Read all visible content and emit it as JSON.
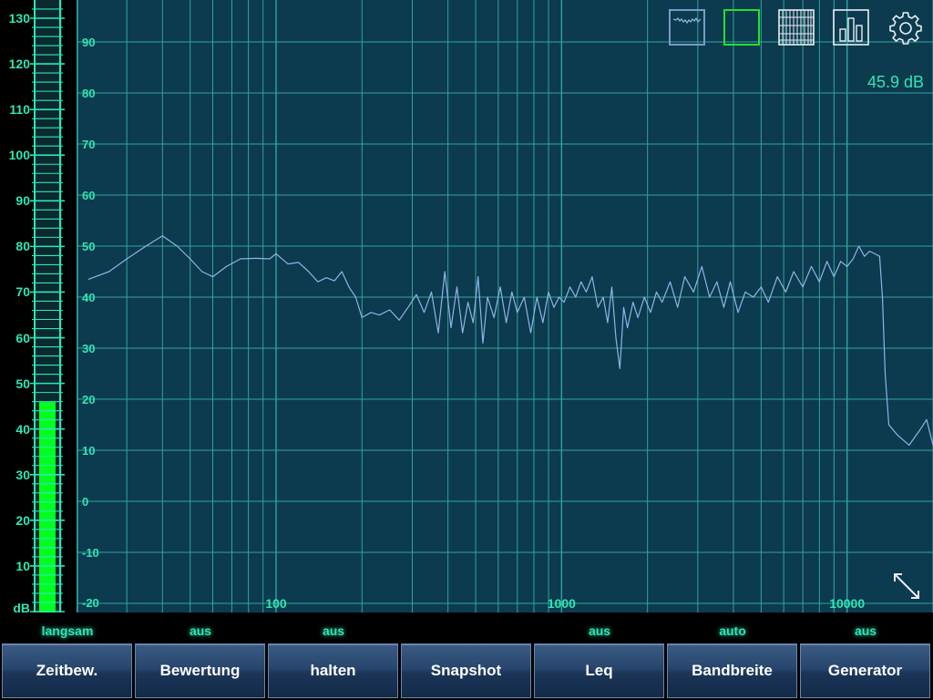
{
  "meter": {
    "unit_label": "dB",
    "scale_labels": [
      "130",
      "120",
      "110",
      "100",
      "90",
      "80",
      "70",
      "60",
      "50",
      "40",
      "30",
      "20",
      "10"
    ],
    "level_db": 45.9,
    "scale_min": 0,
    "scale_max": 130,
    "bar_color": "#00ff1e",
    "scale_color": "#2fe6b4"
  },
  "plot": {
    "background": "#0c3a4e",
    "grid_color": "#2fa5a0",
    "line_color": "#8fb4e8",
    "y_labels": [
      "90",
      "80",
      "70",
      "60",
      "50",
      "40",
      "30",
      "20",
      "10",
      "0",
      "-10",
      "-20"
    ],
    "x_labels": [
      "100",
      "1000",
      "10000"
    ],
    "level_readout": "45.9 dB"
  },
  "toolbar_icons": [
    {
      "name": "spectrum-view-icon",
      "label": "spectrum view"
    },
    {
      "name": "blank-view-icon",
      "label": "blank view"
    },
    {
      "name": "grid-view-icon",
      "label": "grid view"
    },
    {
      "name": "bar-chart-view-icon",
      "label": "bar chart view"
    },
    {
      "name": "settings-gear-icon",
      "label": "settings"
    }
  ],
  "chart_data": {
    "type": "line",
    "xscale": "log",
    "xlim": [
      20,
      20000
    ],
    "ylim": [
      -20,
      100
    ],
    "x_ticks": [
      100,
      1000,
      10000
    ],
    "y_ticks": [
      -20,
      -10,
      0,
      10,
      20,
      30,
      40,
      50,
      60,
      70,
      80,
      90
    ],
    "grid": true,
    "series": [
      {
        "points": [
          [
            22,
            43.5
          ],
          [
            26,
            45
          ],
          [
            30,
            47.5
          ],
          [
            35,
            50
          ],
          [
            40,
            52
          ],
          [
            45,
            50
          ],
          [
            50,
            47.5
          ],
          [
            55,
            45
          ],
          [
            60,
            44
          ],
          [
            67,
            46
          ],
          [
            75,
            47.5
          ],
          [
            85,
            47.6
          ],
          [
            95,
            47.5
          ],
          [
            100,
            48.5
          ],
          [
            110,
            46.5
          ],
          [
            120,
            46.8
          ],
          [
            130,
            45
          ],
          [
            140,
            43
          ],
          [
            150,
            43.8
          ],
          [
            160,
            43.2
          ],
          [
            170,
            45
          ],
          [
            180,
            42
          ],
          [
            190,
            40
          ],
          [
            200,
            36
          ],
          [
            215,
            37
          ],
          [
            230,
            36.5
          ],
          [
            250,
            37.5
          ],
          [
            270,
            35.5
          ],
          [
            290,
            38
          ],
          [
            310,
            40.5
          ],
          [
            330,
            37
          ],
          [
            350,
            41
          ],
          [
            370,
            33
          ],
          [
            390,
            45
          ],
          [
            410,
            34
          ],
          [
            430,
            42
          ],
          [
            450,
            33
          ],
          [
            470,
            39
          ],
          [
            490,
            35
          ],
          [
            510,
            44
          ],
          [
            530,
            31
          ],
          [
            550,
            40
          ],
          [
            580,
            36
          ],
          [
            610,
            42
          ],
          [
            640,
            35
          ],
          [
            670,
            41
          ],
          [
            700,
            37
          ],
          [
            740,
            40
          ],
          [
            780,
            33
          ],
          [
            820,
            40
          ],
          [
            860,
            35
          ],
          [
            900,
            41
          ],
          [
            940,
            38
          ],
          [
            980,
            40
          ],
          [
            1020,
            39
          ],
          [
            1070,
            42
          ],
          [
            1120,
            40
          ],
          [
            1170,
            43
          ],
          [
            1220,
            41
          ],
          [
            1280,
            44
          ],
          [
            1340,
            38
          ],
          [
            1400,
            40
          ],
          [
            1450,
            35
          ],
          [
            1500,
            42
          ],
          [
            1550,
            32
          ],
          [
            1600,
            26
          ],
          [
            1650,
            38
          ],
          [
            1700,
            34
          ],
          [
            1780,
            39
          ],
          [
            1850,
            36
          ],
          [
            1950,
            40
          ],
          [
            2050,
            37
          ],
          [
            2150,
            41
          ],
          [
            2250,
            39
          ],
          [
            2400,
            43
          ],
          [
            2550,
            38
          ],
          [
            2700,
            44
          ],
          [
            2900,
            41
          ],
          [
            3100,
            46
          ],
          [
            3300,
            40
          ],
          [
            3500,
            43
          ],
          [
            3700,
            38
          ],
          [
            3900,
            43
          ],
          [
            4150,
            37
          ],
          [
            4400,
            41
          ],
          [
            4700,
            40
          ],
          [
            5000,
            42
          ],
          [
            5300,
            39
          ],
          [
            5700,
            44
          ],
          [
            6100,
            41
          ],
          [
            6500,
            45
          ],
          [
            7000,
            42
          ],
          [
            7500,
            46
          ],
          [
            8000,
            43
          ],
          [
            8500,
            47
          ],
          [
            9000,
            44
          ],
          [
            9500,
            47
          ],
          [
            10000,
            46
          ],
          [
            10500,
            47.5
          ],
          [
            11000,
            50
          ],
          [
            11500,
            48
          ],
          [
            12000,
            49
          ],
          [
            12500,
            48.5
          ],
          [
            13000,
            48
          ],
          [
            13300,
            40
          ],
          [
            13600,
            25
          ],
          [
            14000,
            15
          ],
          [
            15000,
            13
          ],
          [
            16500,
            11
          ],
          [
            18000,
            14
          ],
          [
            19000,
            16
          ],
          [
            20000,
            11
          ]
        ]
      }
    ]
  },
  "status_labels": [
    "langsam",
    "aus",
    "aus",
    "",
    "aus",
    "auto",
    "aus"
  ],
  "buttons": [
    "Zeitbew.",
    "Bewertung",
    "halten",
    "Snapshot",
    "Leq",
    "Bandbreite",
    "Generator"
  ]
}
